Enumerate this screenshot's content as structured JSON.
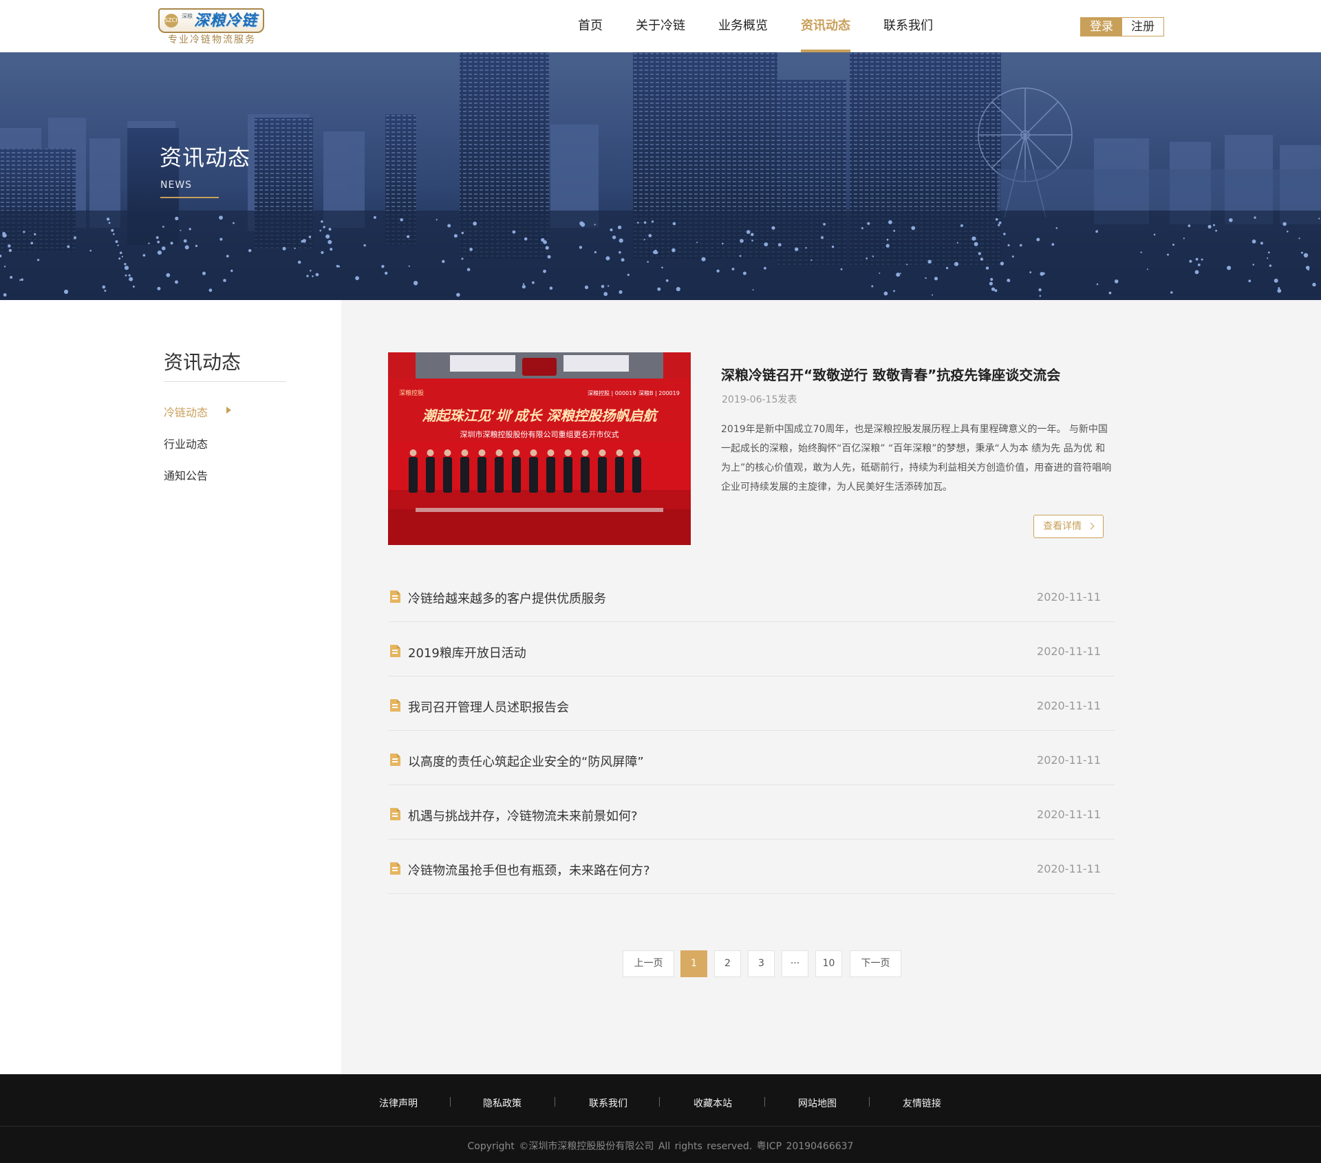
{
  "brand": {
    "small_label": "深粮",
    "seal_text": "SZCH",
    "name": "深粮冷链",
    "slogan": "专业冷链物流服务"
  },
  "nav": {
    "items": [
      {
        "label": "首页"
      },
      {
        "label": "关于冷链"
      },
      {
        "label": "业务概览"
      },
      {
        "label": "资讯动态",
        "active": true
      },
      {
        "label": "联系我们"
      }
    ],
    "login_label": "登录",
    "register_label": "注册"
  },
  "banner": {
    "title": "资讯动态",
    "subtitle": "NEWS"
  },
  "sidebar": {
    "title": "资讯动态",
    "items": [
      {
        "label": "冷链动态",
        "active": true
      },
      {
        "label": "行业动态"
      },
      {
        "label": "通知公告"
      }
    ]
  },
  "featured": {
    "image": {
      "headline": "潮起珠江见‘圳’成长  深粮控股扬帆启航",
      "caption": "深圳市深粮控股股份有限公司重组更名开市仪式",
      "logo_text": "深粮控股",
      "ticker1": "深粮控股 | 000019",
      "ticker2": "深粮B | 200019"
    },
    "title": "深粮冷链召开“致敬逆行 致敬青春”抗疫先锋座谈交流会",
    "date": "2019-06-15发表",
    "description": "2019年是新中国成立70周年，也是深粮控股发展历程上具有里程碑意义的一年。 与新中国一起成长的深粮，始终胸怀“百亿深粮” “百年深粮”的梦想，秉承“人为本 绩为先 品为优 和为上”的核心价值观，敢为人先，砥砺前行，持续为利益相关方创造价值，用奋进的音符唱响企业可持续发展的主旋律，为人民美好生活添砖加瓦。",
    "more_label": "查看详情"
  },
  "news_list": [
    {
      "title": "冷链给越来越多的客户提供优质服务",
      "date": "2020-11-11"
    },
    {
      "title": "2019粮库开放日活动",
      "date": "2020-11-11"
    },
    {
      "title": "我司召开管理人员述职报告会",
      "date": "2020-11-11"
    },
    {
      "title": "以高度的责任心筑起企业安全的“防风屏障”",
      "date": "2020-11-11"
    },
    {
      "title": "机遇与挑战并存，冷链物流未来前景如何?",
      "date": "2020-11-11"
    },
    {
      "title": "冷链物流虽抢手但也有瓶颈，未来路在何方?",
      "date": "2020-11-11"
    }
  ],
  "pagination": {
    "prev_label": "上一页",
    "pages": [
      "1",
      "2",
      "3",
      "···",
      "10"
    ],
    "current": "1",
    "next_label": "下一页"
  },
  "footer": {
    "links": [
      "法律声明",
      "隐私政策",
      "联系我们",
      "收藏本站",
      "网站地图",
      "友情链接"
    ],
    "copyright": "Copyright ©深圳市深粮控股股份有限公司 All rights reserved. 粤ICP 20190466637"
  },
  "colors": {
    "accent": "#c9a05a",
    "footer_bg": "#131313",
    "content_bg": "#f4f4f4"
  }
}
